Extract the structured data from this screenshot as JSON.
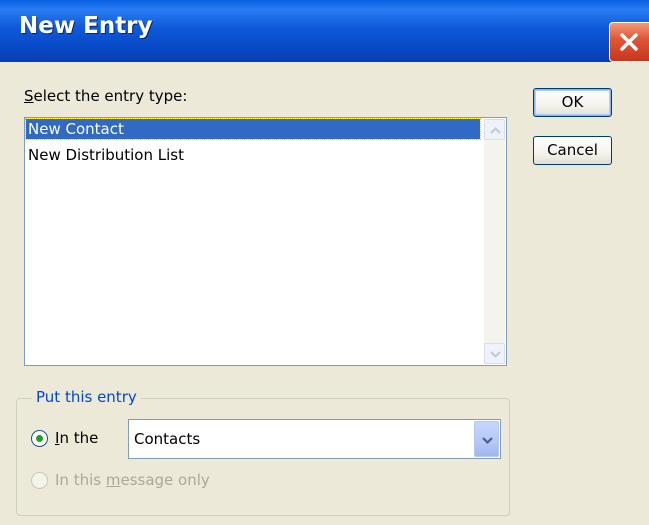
{
  "window": {
    "title": "New Entry"
  },
  "entry_type": {
    "label": "Select the entry type:",
    "items": [
      "New Contact",
      "New Distribution List"
    ],
    "selected_index": 0
  },
  "buttons": {
    "ok": "OK",
    "cancel": "Cancel"
  },
  "location": {
    "group_title": "Put this entry",
    "in_the_label": "In the",
    "folder": "Contacts",
    "message_only_label": "In this message only",
    "selected_option": "in_the"
  },
  "colors": {
    "title_bar": "#0a5fe0",
    "selection": "#316ac5",
    "group_title": "#0046d5",
    "radio_dot": "#21a121"
  }
}
